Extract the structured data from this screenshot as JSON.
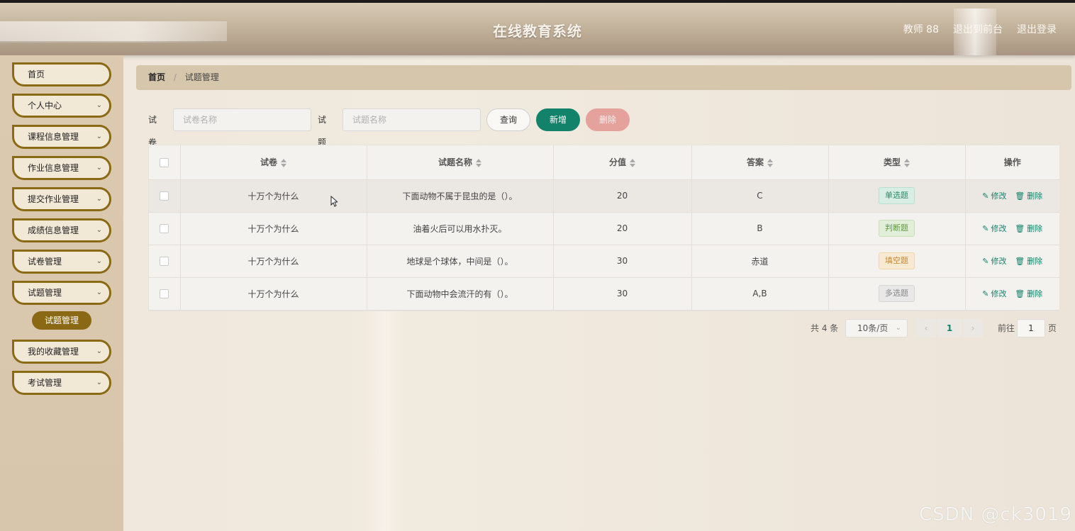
{
  "header": {
    "title": "在线教育系统",
    "user": "教师 88",
    "to_front": "退出到前台",
    "logout": "退出登录"
  },
  "sidebar": {
    "items": [
      {
        "label": "首页",
        "has_chevron": false
      },
      {
        "label": "个人中心",
        "has_chevron": true
      },
      {
        "label": "课程信息管理",
        "has_chevron": true
      },
      {
        "label": "作业信息管理",
        "has_chevron": true
      },
      {
        "label": "提交作业管理",
        "has_chevron": true
      },
      {
        "label": "成绩信息管理",
        "has_chevron": true
      },
      {
        "label": "试卷管理",
        "has_chevron": true
      },
      {
        "label": "试题管理",
        "has_chevron": true
      },
      {
        "label": "我的收藏管理",
        "has_chevron": true
      },
      {
        "label": "考试管理",
        "has_chevron": true
      }
    ],
    "active_sub": "试题管理"
  },
  "breadcrumb": {
    "home": "首页",
    "separator": "/",
    "current": "试题管理"
  },
  "filter": {
    "paper_label": "试卷",
    "paper_placeholder": "试卷名称",
    "question_label": "试题",
    "question_placeholder": "试题名称",
    "query": "查询",
    "add": "新增",
    "delete": "删除"
  },
  "table": {
    "columns": [
      "试卷",
      "试题名称",
      "分值",
      "答案",
      "类型",
      "操作"
    ],
    "rows": [
      {
        "paper": "十万个为什么",
        "name": "下面动物不属于昆虫的是（）。",
        "score": "20",
        "answer": "C",
        "type": "单选题"
      },
      {
        "paper": "十万个为什么",
        "name": "油着火后可以用水扑灭。",
        "score": "20",
        "answer": "B",
        "type": "判断题"
      },
      {
        "paper": "十万个为什么",
        "name": "地球是个球体，中间是（）。",
        "score": "30",
        "answer": "赤道",
        "type": "填空题"
      },
      {
        "paper": "十万个为什么",
        "name": "下面动物中会流汗的有（）。",
        "score": "30",
        "answer": "A,B",
        "type": "多选题"
      }
    ],
    "edit_label": "修改",
    "delete_label": "删除"
  },
  "pagination": {
    "total": "共 4 条",
    "page_size": "10条/页",
    "current_page": "1",
    "goto_label": "前往",
    "goto_value": "1",
    "page_suffix": "页"
  },
  "colors": {
    "accent": "#13826a",
    "sidebar_border": "#8a6a14",
    "active_sub_bg": "#8b6914",
    "delete_btn": "#e5a19c"
  },
  "watermark": "CSDN @ck3019"
}
